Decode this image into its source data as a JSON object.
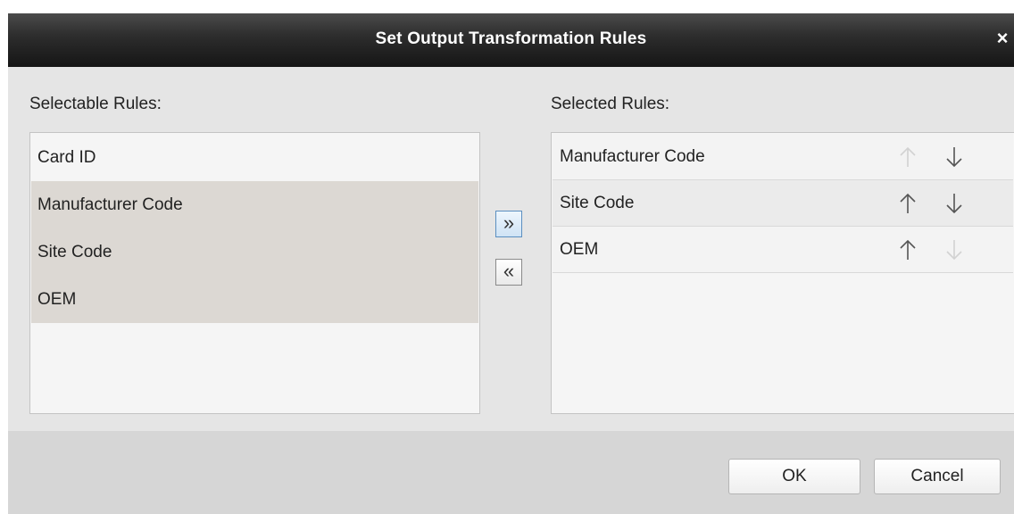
{
  "dialog": {
    "title": "Set Output Transformation Rules",
    "close_glyph": "×"
  },
  "selectable": {
    "label": "Selectable Rules:",
    "items": [
      {
        "label": "Card ID",
        "selected": false
      },
      {
        "label": "Manufacturer Code",
        "selected": true
      },
      {
        "label": "Site Code",
        "selected": true
      },
      {
        "label": "OEM",
        "selected": true
      }
    ]
  },
  "selected": {
    "label": "Selected Rules:",
    "items": [
      {
        "label": "Manufacturer Code",
        "up_enabled": false,
        "down_enabled": true
      },
      {
        "label": "Site Code",
        "up_enabled": true,
        "down_enabled": true
      },
      {
        "label": "OEM",
        "up_enabled": true,
        "down_enabled": false
      }
    ]
  },
  "transfer": {
    "add_glyph": "»",
    "remove_glyph": "«"
  },
  "footer": {
    "ok_label": "OK",
    "cancel_label": "Cancel"
  },
  "colors": {
    "titlebar": "#1e1e1e",
    "selection": "#dcd8d3",
    "dialog_bg": "#e5e5e5"
  },
  "icons": {
    "up": "arrow-up-icon",
    "down": "arrow-down-icon"
  }
}
